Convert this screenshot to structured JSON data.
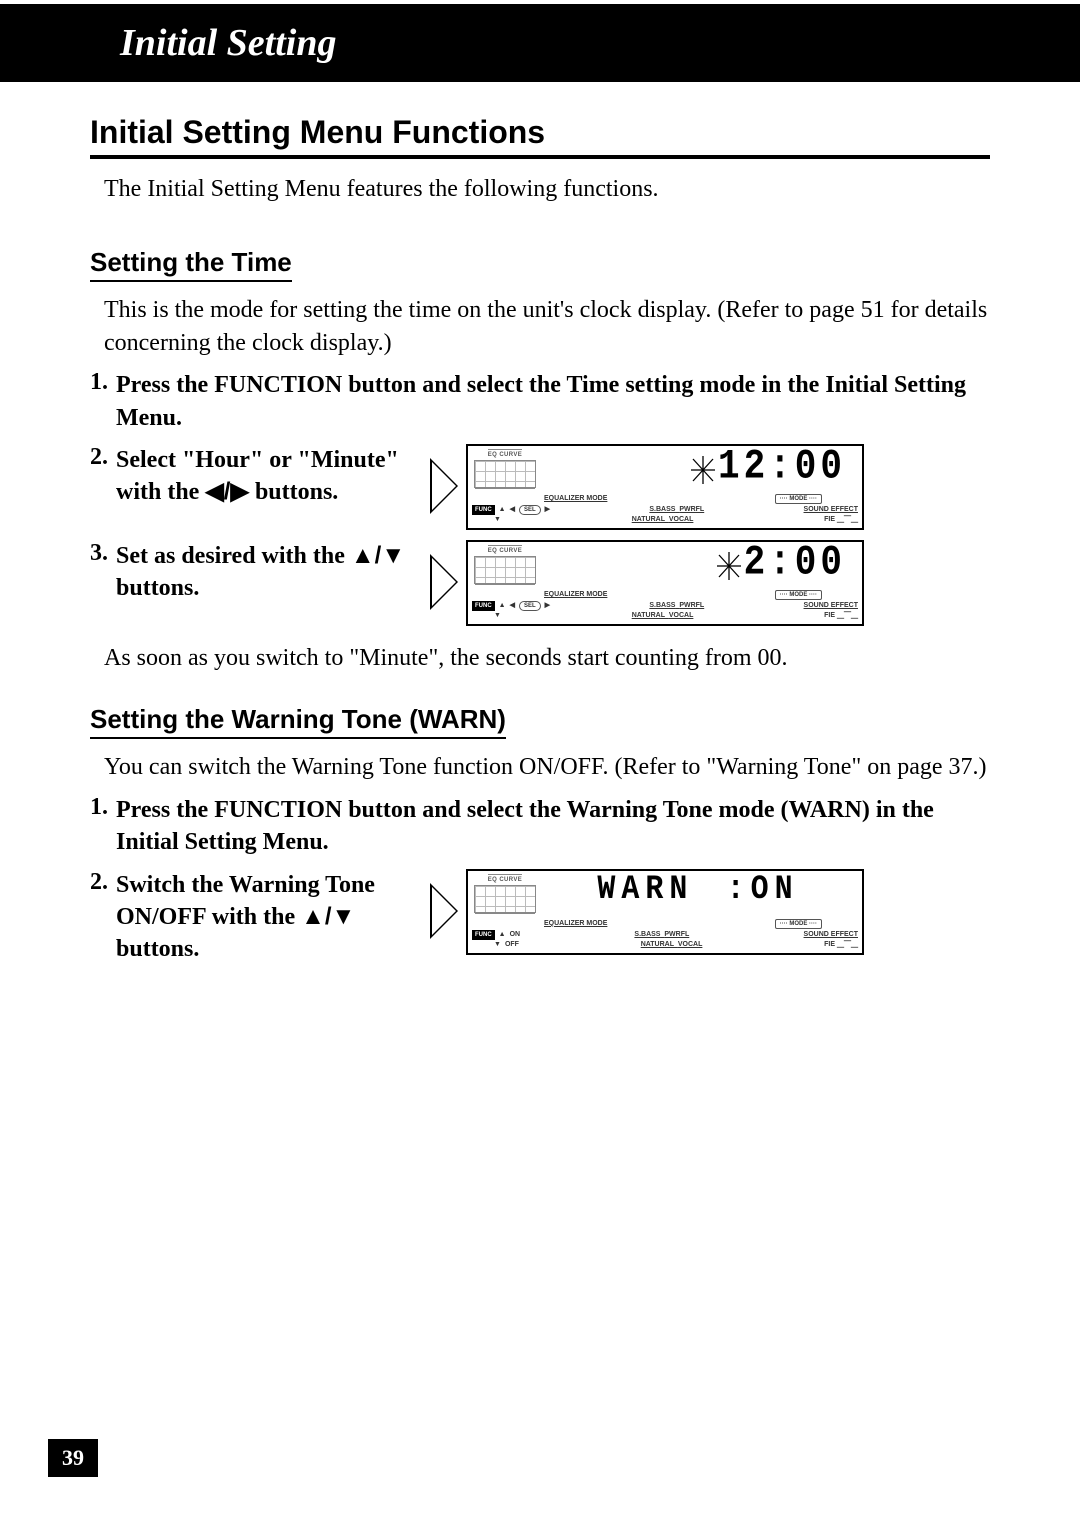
{
  "header": {
    "title": "Initial Setting"
  },
  "section": {
    "heading": "Initial Setting Menu Functions",
    "intro": "The Initial Setting Menu features the following functions."
  },
  "time": {
    "subheading": "Setting the Time",
    "intro": "This is the mode for setting the time on the unit's clock display. (Refer to page 51 for details concerning the clock display.)",
    "step1": "Press the FUNCTION button and select the Time setting mode in the Initial Setting Menu.",
    "step2_a": "Select \"Hour\" or \"Minute\" with the ",
    "step2_b": " buttons.",
    "step3_a": "Set as desired with the ",
    "step3_b": " buttons.",
    "display1": "12:00",
    "display2": " 2:00",
    "note": "As soon as you switch to \"Minute\", the seconds start counting from 00."
  },
  "warn": {
    "subheading": "Setting the Warning Tone (WARN)",
    "intro": "You can switch the Warning Tone function ON/OFF. (Refer to \"Warning Tone\" on page 37.)",
    "step1": "Press the FUNCTION button and select the Warning Tone mode (WARN) in the Initial Setting Menu.",
    "step2_a": "Switch the Warning Tone ON/OFF with the ",
    "step2_b": " buttons.",
    "display_label": "WARN",
    "display_val": ":ON",
    "on_label": "ON",
    "off_label": "OFF"
  },
  "lcd_labels": {
    "eq_curve": "EQ CURVE",
    "equalizer_mode": "EQUALIZER MODE",
    "mode": "···· MODE ····",
    "sound_effect": "SOUND EFFECT",
    "sbass": "S.BASS",
    "pwrfl": "PWRFL",
    "natural": "NATURAL",
    "vocal": "VOCAL",
    "fie": "FIE",
    "func": "FUNC",
    "sel": "SEL"
  },
  "arrows": {
    "lr": "◀/▶",
    "ud": "▲/▼"
  },
  "page_number": "39"
}
